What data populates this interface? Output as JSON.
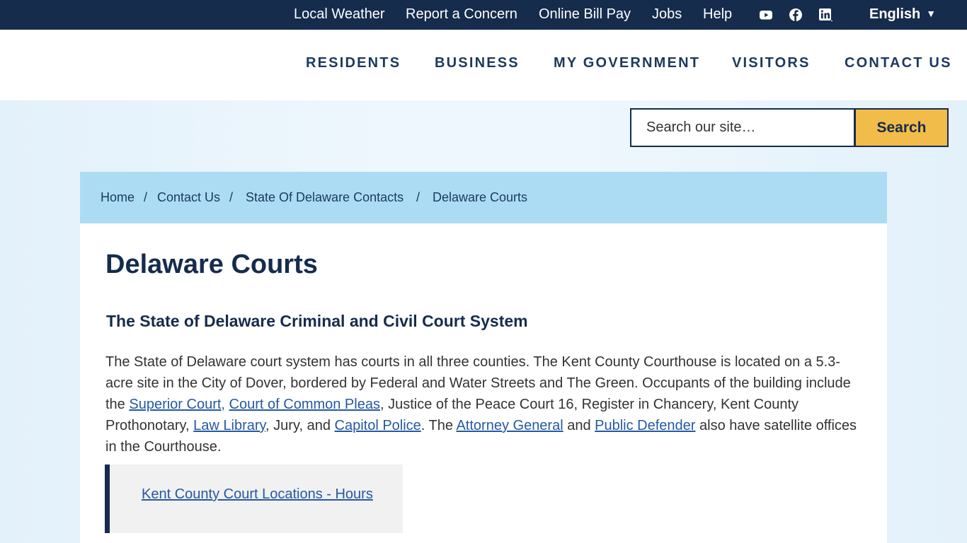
{
  "topbar": {
    "links": [
      "Local Weather",
      "Report a Concern",
      "Online Bill Pay",
      "Jobs",
      "Help"
    ],
    "social_icons": [
      "youtube-icon",
      "facebook-icon",
      "linkedin-icon"
    ],
    "language": "English",
    "language_caret": "▼"
  },
  "nav": {
    "items": [
      "RESIDENTS",
      "BUSINESS",
      "MY GOVERNMENT",
      "VISITORS",
      "CONTACT US"
    ]
  },
  "search": {
    "placeholder": "Search our site…",
    "button_label": "Search"
  },
  "breadcrumb": {
    "items": [
      "Home",
      "Contact Us",
      "State Of Delaware Contacts",
      "Delaware Courts"
    ],
    "separator": "/"
  },
  "page": {
    "title": "Delaware Courts",
    "section_heading": "The State of Delaware Criminal and Civil Court System",
    "paragraph": {
      "t1": "The State of Delaware court system has courts in all three counties. The Kent County Courthouse is located on a 5.3-acre site in the City of Dover, bordered by Federal and Water Streets and The Green. Occupants of the building include the ",
      "link_superior": "Superior Court,",
      "t2": " ",
      "link_common_pleas": "Court of Common Pleas",
      "t3": ", Justice of the Peace Court 16, Register in Chancery, Kent County Prothonotary, ",
      "link_law_library": "Law Library",
      "t4": ", Jury, and ",
      "link_capitol_police": "Capitol Police",
      "t5": ". The ",
      "link_attorney_general": "Attorney General",
      "t6": " and ",
      "link_public_defender": "Public Defender",
      "t7": " also have satellite offices in the Courthouse."
    },
    "callout_link": "Kent County Court Locations - Hours"
  },
  "colors": {
    "navy": "#152c4c",
    "nav_text": "#1a3a5e",
    "breadcrumb_bg": "#acdcf4",
    "search_button": "#f2bc4a",
    "link": "#2459a3",
    "callout_bg": "#f1f1f1"
  }
}
